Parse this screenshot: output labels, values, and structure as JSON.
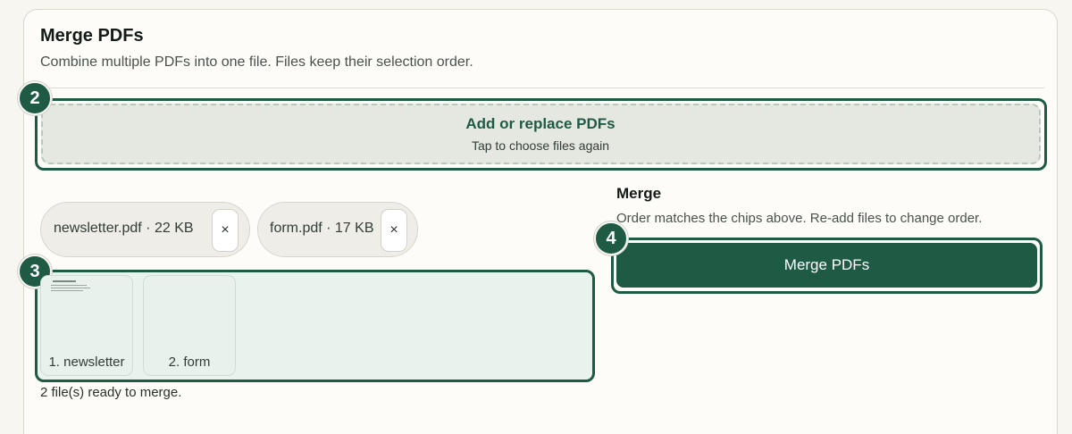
{
  "header": {
    "title": "Merge PDFs",
    "subtitle": "Combine multiple PDFs into one file. Files keep their selection order."
  },
  "dropzone": {
    "title": "Add or replace PDFs",
    "subtitle": "Tap to choose files again"
  },
  "badges": [
    "2",
    "3",
    "4"
  ],
  "chips": [
    {
      "label": "newsletter.pdf · 22 KB",
      "remove": "×"
    },
    {
      "label": "form.pdf · 17 KB",
      "remove": "×"
    }
  ],
  "thumbnails": [
    {
      "label": "1. newsletter"
    },
    {
      "label": "2. form"
    }
  ],
  "status": "2 file(s) ready to merge.",
  "merge": {
    "title": "Merge",
    "subtitle": "Order matches the chips above. Re-add files to change order.",
    "button": "Merge PDFs"
  },
  "colors": {
    "accent": "#1f5a45",
    "background": "#f7f6f1",
    "dropzone": "#e5e8e1"
  }
}
